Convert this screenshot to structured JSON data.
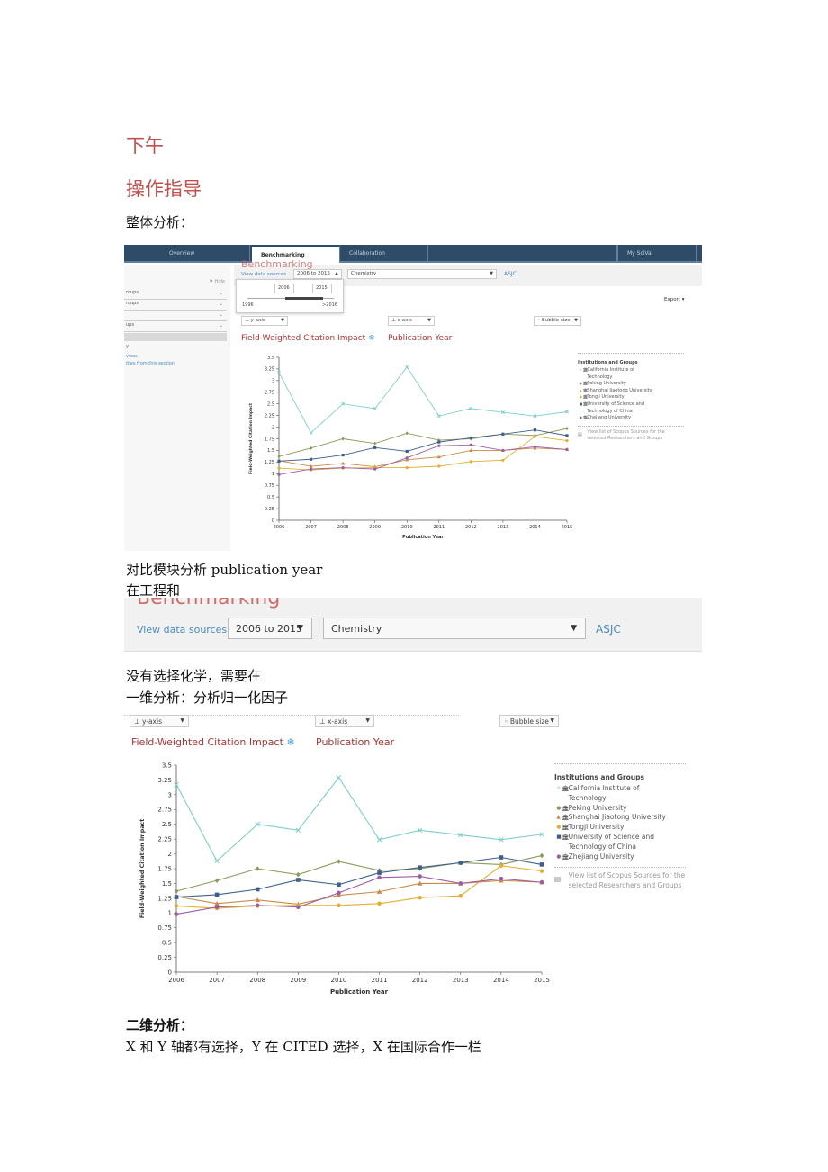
{
  "doc": {
    "heading1": "下午",
    "heading2": "操作指导",
    "section_overall": "整体分析：",
    "para_compare": "对比模块分析 publication year",
    "para_engineering": "在工程和",
    "para_no_chem": "没有选择化学，需要在",
    "para_one_dim": "一维分析：分析归一化因子",
    "section_two_dim": "二维分析：",
    "para_xy": "X 和 Y 轴都有选择，Y 在 CITED 选择，X 在国际合作一栏"
  },
  "scival": {
    "nav": {
      "tabs": [
        "Overview",
        "Benchmarking",
        "Collaboration"
      ],
      "active": "Benchmarking",
      "my_scival": "My SciVal"
    },
    "toolbar": {
      "page_title": "Benchmarking",
      "view_data_sources": "View data sources",
      "year_range": "2006 to 2015",
      "subject": "Chemistry",
      "asjc": "ASJC"
    },
    "year_popup": {
      "start": "2006",
      "end": "2015",
      "min": "1996",
      "max": ">2016"
    },
    "sidebar": {
      "hide_label": "Hide",
      "rows": [
        "roups",
        "roups",
        "",
        "ups"
      ],
      "y_label": "y",
      "link1": "vwas",
      "link2": "ities from this section"
    },
    "controls": {
      "y_axis": "y-axis",
      "x_axis": "x-axis",
      "bubble_size": "Bubble size",
      "export": "Export"
    },
    "legend": {
      "title": "Institutions and Groups",
      "items": [
        {
          "line1": "California Institute of",
          "line2": "Technology",
          "color": "#7ecfc8",
          "marker": "x"
        },
        {
          "line1": "Peking University",
          "line2": "",
          "color": "#8c9a5b",
          "marker": "diamond"
        },
        {
          "line1": "Shanghai Jiaotong University",
          "line2": "",
          "color": "#c98a4b",
          "marker": "triangle"
        },
        {
          "line1": "Tongji University",
          "line2": "",
          "color": "#e0b030",
          "marker": "circle"
        },
        {
          "line1": "University of Science and",
          "line2": "Technology of China",
          "color": "#3f5f8a",
          "marker": "square"
        },
        {
          "line1": "Zhejiang University",
          "line2": "",
          "color": "#9b5fa0",
          "marker": "circle"
        }
      ],
      "sources_line1": "View list of Scopus Sources for the",
      "sources_line2": "selected Researchers and Groups"
    }
  },
  "chart_data": {
    "type": "line",
    "title": "Field-Weighted Citation Impact",
    "x_metric": "Publication Year",
    "xlabel": "Publication Year",
    "ylabel": "Field-Weighted Citation Impact",
    "ylim": [
      0,
      3.5
    ],
    "yticks": [
      "0",
      "0.25",
      "0.5",
      "0.75",
      "1",
      "1.25",
      "1.5",
      "1.75",
      "2",
      "2.25",
      "2.5",
      "2.75",
      "3",
      "3.25",
      "3.5"
    ],
    "x": [
      "2006",
      "2007",
      "2008",
      "2009",
      "2010",
      "2011",
      "2012",
      "2013",
      "2014",
      "2015"
    ],
    "grid": false,
    "legend_position": "right",
    "series": [
      {
        "name": "California Institute of Technology",
        "color": "#7ecfc8",
        "values": [
          3.17,
          1.88,
          2.5,
          2.4,
          3.29,
          2.24,
          2.4,
          2.32,
          2.24,
          2.33
        ]
      },
      {
        "name": "Peking University",
        "color": "#8c9a5b",
        "values": [
          1.37,
          1.55,
          1.75,
          1.65,
          1.87,
          1.72,
          1.75,
          1.85,
          1.82,
          1.97
        ]
      },
      {
        "name": "Shanghai Jiaotong University",
        "color": "#c98a4b",
        "values": [
          1.28,
          1.16,
          1.22,
          1.15,
          1.3,
          1.36,
          1.5,
          1.5,
          1.55,
          1.52
        ]
      },
      {
        "name": "Tongji University",
        "color": "#e0b030",
        "values": [
          1.12,
          1.08,
          1.12,
          1.13,
          1.13,
          1.16,
          1.26,
          1.29,
          1.8,
          1.71
        ]
      },
      {
        "name": "University of Science and Technology of China",
        "color": "#3f5f8a",
        "values": [
          1.27,
          1.31,
          1.4,
          1.56,
          1.48,
          1.68,
          1.77,
          1.85,
          1.94,
          1.82
        ]
      },
      {
        "name": "Zhejiang University",
        "color": "#9b5fa0",
        "values": [
          0.98,
          1.1,
          1.13,
          1.1,
          1.34,
          1.6,
          1.62,
          1.5,
          1.58,
          1.52
        ]
      }
    ]
  }
}
